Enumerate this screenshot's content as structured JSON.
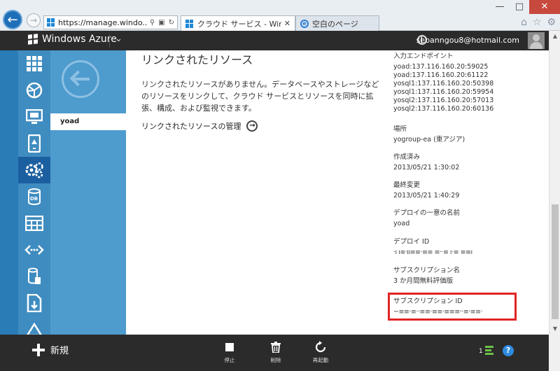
{
  "browser": {
    "url": "https://manage.windo...",
    "tabs": [
      {
        "label": "クラウド サービス - Windows ..."
      },
      {
        "label": "空白のページ"
      }
    ],
    "controls": {
      "minimize": "—",
      "maximize": "□",
      "close": "✕"
    }
  },
  "header": {
    "brand": "Windows Azure",
    "user_email": "sebanngou8@hotmail.com"
  },
  "sidebar": {
    "icons": [
      "all-items-icon",
      "web-sites-icon",
      "virtual-machines-icon",
      "mobile-services-icon",
      "cloud-services-icon",
      "sql-databases-icon",
      "storage-icon",
      "service-bus-icon",
      "media-services-icon",
      "import-export-icon",
      "networks-icon"
    ],
    "active_index": 4
  },
  "subnav": {
    "selected_item": "yoad"
  },
  "main": {
    "title": "リンクされたリソース",
    "description": "リンクされたリソースがありません。データベースやストレージなどのリソースをリンクして、クラウド サービスとリソースを同時に拡張、構成、および監視できます。",
    "manage_link": "リンクされたリソースの管理"
  },
  "properties": {
    "endpoints_label": "入力エンドポイント",
    "endpoints": [
      "yoad:137.116.160.20:59025",
      "yoad:137.116.160.20:61122",
      "yosql1:137.116.160.20:50398",
      "yosql1:137.116.160.20:59954",
      "yosql2:137.116.160.20:57013",
      "yosql2:137.116.160.20:60136"
    ],
    "location_label": "場所",
    "location_value": "yogroup-ea (東アジア)",
    "created_label": "作成済み",
    "created_value": "2013/05/21 1:30:02",
    "modified_label": "最終変更",
    "modified_value": "2013/05/21 1:40:29",
    "deploy_name_label": "デプロイの一意の名前",
    "deploy_name_value": "yoad",
    "deploy_id_label": "デプロイ ID",
    "deploy_id_value": "·ı ı≡·ıı≡≡·≡≡ ≡··≡ ı·≡ ≡≡ı",
    "subscription_name_label": "サブスクリプション名",
    "subscription_name_value": "3 か月間無料評価版",
    "subscription_id_label": "サブスクリプション ID",
    "subscription_id_value": "~≡≡·≡··≡≡·≡≡·≡≡≡··≡·≡≡·"
  },
  "command_bar": {
    "new_label": "新規",
    "stop_label": "停止",
    "delete_label": "削除",
    "restart_label": "再起動",
    "notification_count": "1",
    "help_label": "?"
  },
  "colors": {
    "azure_blue": "#3f8cc0",
    "active_blue": "#1b5fa0",
    "dark_bar": "#2b2b2b",
    "highlight_red": "#e02424"
  }
}
